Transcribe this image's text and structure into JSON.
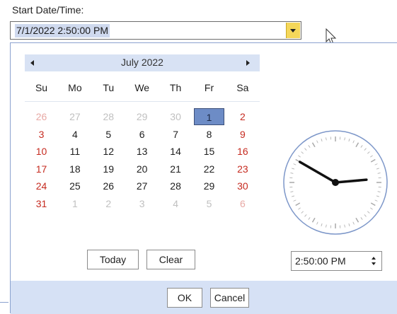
{
  "field": {
    "label": "Start Date/Time:",
    "value": "7/1/2022 2:50:00 PM"
  },
  "calendar": {
    "month_title": "July 2022",
    "day_headers": [
      "Su",
      "Mo",
      "Tu",
      "We",
      "Th",
      "Fr",
      "Sa"
    ],
    "weeks": [
      [
        {
          "d": "26",
          "o": true
        },
        {
          "d": "27",
          "o": true
        },
        {
          "d": "28",
          "o": true
        },
        {
          "d": "29",
          "o": true
        },
        {
          "d": "30",
          "o": true
        },
        {
          "d": "1",
          "sel": true
        },
        {
          "d": "2"
        }
      ],
      [
        {
          "d": "3"
        },
        {
          "d": "4"
        },
        {
          "d": "5"
        },
        {
          "d": "6"
        },
        {
          "d": "7"
        },
        {
          "d": "8"
        },
        {
          "d": "9"
        }
      ],
      [
        {
          "d": "10"
        },
        {
          "d": "11"
        },
        {
          "d": "12"
        },
        {
          "d": "13"
        },
        {
          "d": "14"
        },
        {
          "d": "15"
        },
        {
          "d": "16"
        }
      ],
      [
        {
          "d": "17"
        },
        {
          "d": "18"
        },
        {
          "d": "19"
        },
        {
          "d": "20"
        },
        {
          "d": "21"
        },
        {
          "d": "22"
        },
        {
          "d": "23"
        }
      ],
      [
        {
          "d": "24"
        },
        {
          "d": "25"
        },
        {
          "d": "26"
        },
        {
          "d": "27"
        },
        {
          "d": "28"
        },
        {
          "d": "29"
        },
        {
          "d": "30"
        }
      ],
      [
        {
          "d": "31"
        },
        {
          "d": "1",
          "o": true
        },
        {
          "d": "2",
          "o": true
        },
        {
          "d": "3",
          "o": true
        },
        {
          "d": "4",
          "o": true
        },
        {
          "d": "5",
          "o": true
        },
        {
          "d": "6",
          "o": true
        }
      ]
    ],
    "today_label": "Today",
    "clear_label": "Clear"
  },
  "clock": {
    "hour": 2,
    "minute": 50,
    "second": 0
  },
  "time": {
    "value": "2:50:00 PM"
  },
  "footer": {
    "ok_label": "OK",
    "cancel_label": "Cancel"
  },
  "colors": {
    "header_bg": "#d8e2f4",
    "selected_day": "#6d8cc6",
    "weekend_text": "#c62b20",
    "dropdown_button": "#f5d75a"
  }
}
